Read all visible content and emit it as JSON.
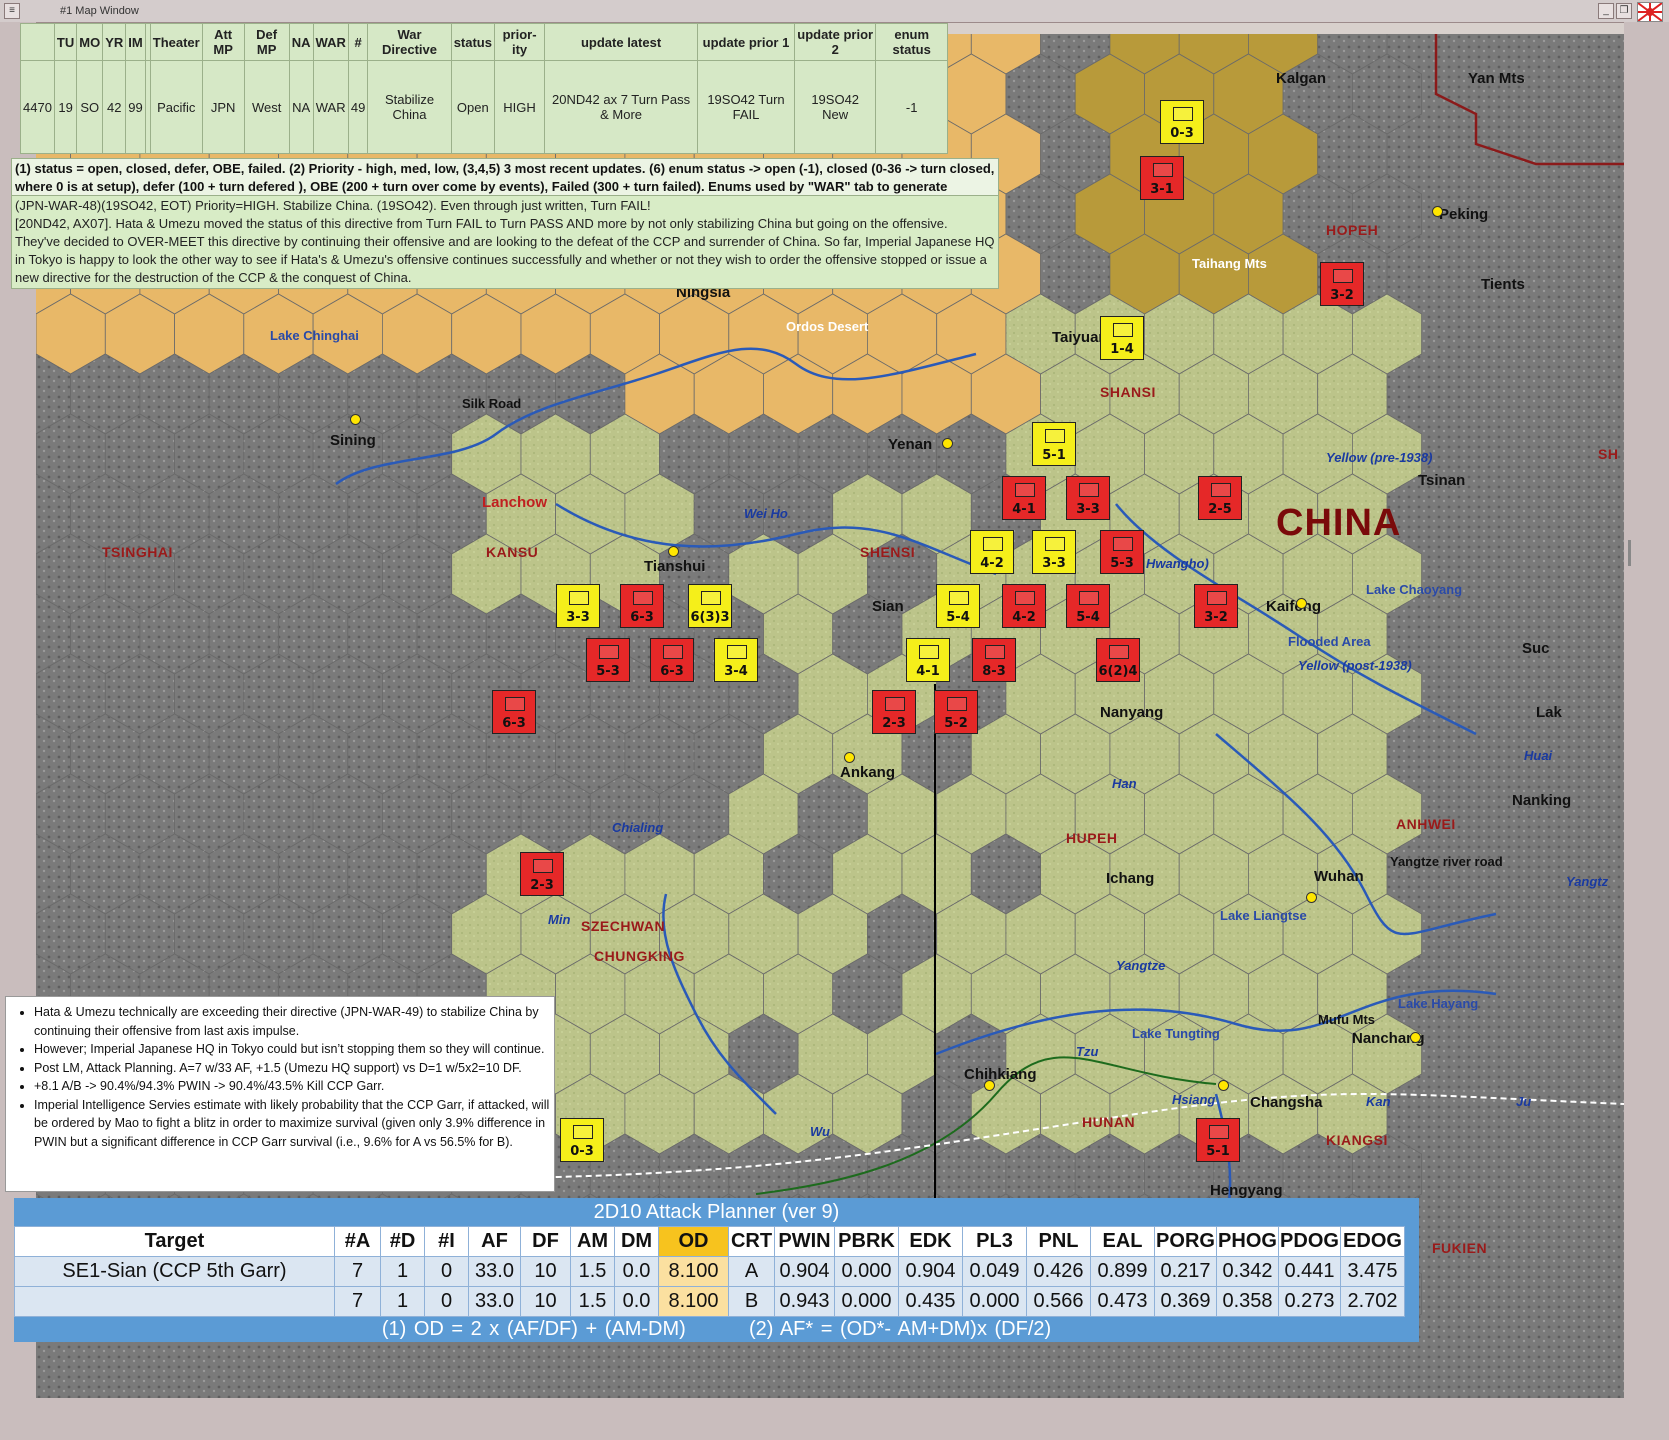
{
  "window": {
    "title": "#1 Map Window"
  },
  "directive_table": {
    "headers": [
      "",
      "TU",
      "MO",
      "YR",
      "IM",
      "",
      "Theater",
      "Att MP",
      "Def MP",
      "NA",
      "WAR",
      "#",
      "War Directive",
      "status",
      "prior-ity",
      "update latest",
      "update prior 1",
      "update prior 2",
      "enum status"
    ],
    "row": [
      "4470",
      "19",
      "SO",
      "42",
      "99",
      "",
      "Pacific",
      "JPN",
      "West",
      "NA",
      "WAR",
      "49",
      "Stabilize China",
      "Open",
      "HIGH",
      "20ND42 ax 7 Turn Pass & More",
      "19SO42 Turn FAIL",
      "19SO42 New",
      "-1"
    ]
  },
  "legend_note": "(1) status = open, closed, defer, OBE, failed.  (2) Priority - high, med, low,  (3,4,5) 3 most recent updates.  (6) enum status -> open (-1), closed (0-36 -> turn closed, where 0 is at setup), defer (100 + turn defered ), OBE (200 + turn over come by events), Failed (300 + turn failed).  Enums used by \"WAR\" tab to generate summaries.",
  "directive_note": {
    "line1": "(JPN-WAR-48)(19SO42, EOT)  Priority=HIGH.  Stabilize China.  (19SO42).  Even through just written, Turn FAIL!",
    "line2": "[20ND42, AX07].  Hata & Umezu moved the status of this directive from Turn FAIL to Turn PASS AND more by not only stabilizing China but going on the offensive.  They've decided to OVER-MEET this directive by continuing their offensive and are looking to the defeat of the CCP and surrender of China.  So far, Imperial Japanese HQ in Tokyo is happy to look the other way to see if Hata's & Umezu's offensive continues successfully and whether or not they wish to order the offensive stopped or issue a new directive for the destruction of the CCP & the conquest of China."
  },
  "bullets": [
    "Hata & Umezu technically are exceeding their directive (JPN-WAR-49) to stabilize China by continuing their offensive from last axis impulse.",
    "However; Imperial Japanese HQ in Tokyo could but isn’t stopping them so they will continue.",
    "Post LM, Attack Planning.  A=7 w/33 AF, +1.5 (Umezu HQ support) vs D=1 w/5x2=10 DF.",
    "+8.1 A/B -> 90.4%/94.3% PWIN -> 90.4%/43.5% Kill CCP Garr.",
    "Imperial Intelligence Servies estimate with likely probability that the CCP Garr, if attacked, will be ordered by Mao to fight a blitz in order to maximize survival (given only 3.9% difference in PWIN but a significant difference in CCP Garr survival (i.e., 9.6% for A vs 56.5% for B)."
  ],
  "planner": {
    "title": "2D10 Attack Planner (ver 9)",
    "headers": [
      "Target",
      "#A",
      "#D",
      "#I",
      "AF",
      "DF",
      "AM",
      "DM",
      "OD",
      "CRT",
      "PWIN",
      "PBRK",
      "EDK",
      "PL3",
      "PNL",
      "EAL",
      "PORG",
      "PHOG",
      "PDOG",
      "EDOG"
    ],
    "rows": [
      [
        "SE1-Sian (CCP 5th Garr)",
        "7",
        "1",
        "0",
        "33.0",
        "10",
        "1.5",
        "0.0",
        "8.100",
        "A",
        "0.904",
        "0.000",
        "0.904",
        "0.049",
        "0.426",
        "0.899",
        "0.217",
        "0.342",
        "0.441",
        "3.475"
      ],
      [
        "",
        "7",
        "1",
        "0",
        "33.0",
        "10",
        "1.5",
        "0.0",
        "8.100",
        "B",
        "0.943",
        "0.000",
        "0.435",
        "0.000",
        "0.566",
        "0.473",
        "0.369",
        "0.358",
        "0.273",
        "2.702"
      ]
    ],
    "formula1": "(1) OD = 2 x (AF/DF) + (AM-DM)",
    "formula2": "(2) AF* = (OD*- AM+DM)x (DF/2)"
  },
  "map": {
    "big_label": "CHINA",
    "provinces": [
      "TSINGHAI",
      "KANSU",
      "SHENSI",
      "SHANSI",
      "HOPEH",
      "HUPEH",
      "SZECHWAN",
      "HUNAN",
      "KIANGSI",
      "ANHWEI",
      "FUKIEN",
      "CHUNGKING",
      "SH"
    ],
    "cities": [
      "Kalgan",
      "Peking",
      "Tients",
      "Taiyuan",
      "Yenan",
      "Sining",
      "Lanchow",
      "Tianshui",
      "Sian",
      "Kaifeng",
      "Tsinan",
      "Ankang",
      "Ichang",
      "Wuhan",
      "Nanking",
      "Nanchang",
      "Changsha",
      "Chihkiang",
      "Hengyang",
      "Ningsia",
      "Yan Mts",
      "Suc",
      "Lak",
      "Yangtze river road",
      "Mufu Mts",
      "Nanyang"
    ],
    "geo_labels": [
      "Taihang Mts",
      "Ordos Desert",
      "Silk Road"
    ],
    "lakes": [
      "Lake Chinghai",
      "Lake Chaoyang",
      "Flooded Area",
      "Lake Liangtse",
      "Lake Tungting",
      "Lake Hayang"
    ],
    "rivers": [
      "Wei Ho",
      "Hwangho)",
      "Yellow (pre-1938)",
      "Yellow (post-1938)",
      "Huai",
      "Han",
      "Chialing",
      "Min",
      "Yangtze",
      "Tzu",
      "Hsiang",
      "Kan",
      "Ju",
      "Wu",
      "Yangtz"
    ],
    "units": [
      {
        "s": "0-3",
        "c": "yel"
      },
      {
        "s": "3-1",
        "c": "red"
      },
      {
        "s": "3-2",
        "c": "red"
      },
      {
        "s": "1-4",
        "c": "yel"
      },
      {
        "s": "5-1",
        "c": "yel"
      },
      {
        "s": "4-1",
        "c": "red"
      },
      {
        "s": "3-3",
        "c": "red"
      },
      {
        "s": "2-5",
        "c": "red"
      },
      {
        "s": "4-2",
        "c": "yel"
      },
      {
        "s": "3-3",
        "c": "yel"
      },
      {
        "s": "5-3",
        "c": "red"
      },
      {
        "s": "3-3",
        "c": "yel"
      },
      {
        "s": "6-3",
        "c": "red"
      },
      {
        "s": "6(3)3",
        "c": "yel"
      },
      {
        "s": "5-4",
        "c": "yel"
      },
      {
        "s": "4-2",
        "c": "red"
      },
      {
        "s": "5-4",
        "c": "red"
      },
      {
        "s": "3-2",
        "c": "red"
      },
      {
        "s": "5-3",
        "c": "red"
      },
      {
        "s": "6-3",
        "c": "red"
      },
      {
        "s": "3-4",
        "c": "yel"
      },
      {
        "s": "4-1",
        "c": "yel"
      },
      {
        "s": "8-3",
        "c": "red"
      },
      {
        "s": "6(2)4",
        "c": "red"
      },
      {
        "s": "6-3",
        "c": "red"
      },
      {
        "s": "2-3",
        "c": "red"
      },
      {
        "s": "5-2",
        "c": "red"
      },
      {
        "s": "2-3",
        "c": "red"
      },
      {
        "s": "0-3",
        "c": "yel"
      },
      {
        "s": "5-1",
        "c": "red"
      }
    ]
  }
}
